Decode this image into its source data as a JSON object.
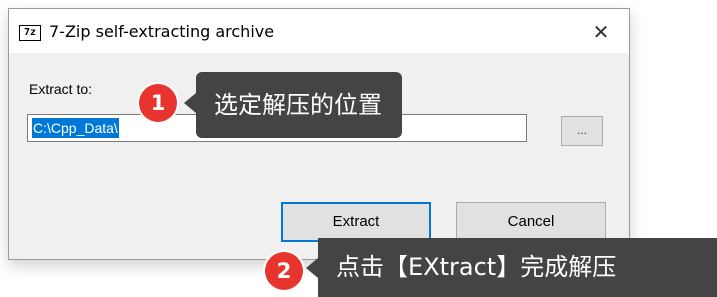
{
  "window": {
    "icon_text": "7z",
    "title": "7-Zip self-extracting archive",
    "close_glyph": "✕"
  },
  "extract": {
    "label": "Extract to:",
    "path_value": "C:\\Cpp_Data\\",
    "browse_label": "..."
  },
  "buttons": {
    "extract_label": "Extract",
    "cancel_label": "Cancel"
  },
  "annotations": [
    {
      "number": "1",
      "text": "选定解压的位置"
    },
    {
      "number": "2",
      "text": "点击【EXtract】完成解压"
    }
  ],
  "colors": {
    "callout_bg": "#444444",
    "badge_red": "#e8342e",
    "selection_blue": "#0078d7"
  }
}
